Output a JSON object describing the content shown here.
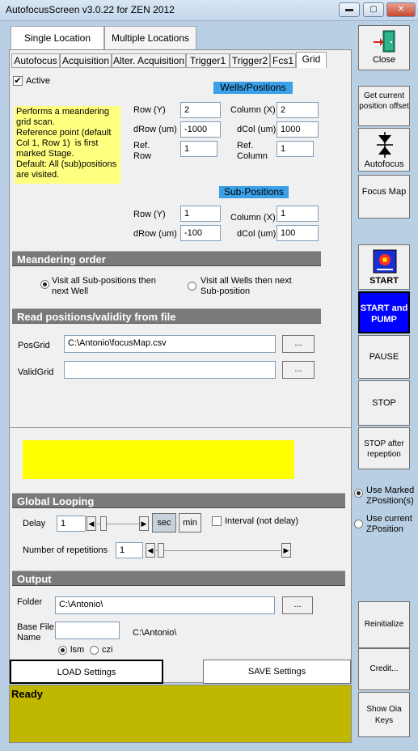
{
  "window": {
    "title": "AutofocusScreen v3.0.22 for ZEN 2012",
    "minimize": "▬",
    "maximize": "▢",
    "close": "✕"
  },
  "location_tabs": [
    "Single Location",
    "Multiple Locations"
  ],
  "sub_tabs": [
    "Autofocus",
    "Acquisition",
    "Alter. Acquisition",
    "Trigger1",
    "Trigger2",
    "Fcs1",
    "Grid"
  ],
  "grid": {
    "active_label": "Active",
    "active_checked": true,
    "info_text": "Performs a meandering grid scan.\nReference point (default Col 1, Row 1)  is first marked Stage.\nDefault: All (sub)positions are visited.",
    "wells_header": "Wells/Positions",
    "row_label": "Row (Y)",
    "row_value": "2",
    "column_label": "Column (X)",
    "column_value": "2",
    "drow_label": "dRow (um)",
    "drow_value": "-1000",
    "dcol_label": "dCol (um)",
    "dcol_value": "1000",
    "refrow_label": "Ref.\nRow",
    "refrow_value": "1",
    "refcol_label": "Ref.\nColumn",
    "refcol_value": "1",
    "subpos_header": "Sub-Positions",
    "sub_row_label": "Row (Y)",
    "sub_row_value": "1",
    "sub_column_label": "Column (X)",
    "sub_column_value": "1",
    "sub_drow_label": "dRow (um)",
    "sub_drow_value": "-100",
    "sub_dcol_label": "dCol (um)",
    "sub_dcol_value": "100"
  },
  "meander": {
    "title": "Meandering order",
    "option1": "Visit all Sub-positions then next Well",
    "option2": "Visit all Wells then next Sub-position",
    "selected": 1
  },
  "readpos": {
    "title": "Read positions/validity from file",
    "posgrid_label": "PosGrid",
    "posgrid_value": "C:\\Antonio\\focusMap.csv",
    "validgrid_label": "ValidGrid",
    "validgrid_value": "",
    "browse_label": "..."
  },
  "looping": {
    "title": "Global Looping",
    "delay_label": "Delay",
    "delay_value": "1",
    "sec_label": "sec",
    "min_label": "min",
    "interval_label": "Interval (not delay)",
    "reps_label": "Number of repetitions",
    "reps_value": "1"
  },
  "output": {
    "title": "Output",
    "folder_label": "Folder",
    "folder_value": "C:\\Antonio\\",
    "browse_label": "...",
    "basefile_label": "Base File\nName",
    "basefile_value": "",
    "path_display": "C:\\Antonio\\",
    "lsm_label": "lsm",
    "czi_label": "czi"
  },
  "settings": {
    "load_label": "LOAD Settings",
    "save_label": "SAVE Settings"
  },
  "status": {
    "text": "Ready"
  },
  "right_panel": {
    "close_label": "Close",
    "get_offset_label": "Get current position offset",
    "autofocus_label": "Autofocus",
    "focus_map_label": "Focus Map",
    "start_label": "START",
    "start_pump_label": "START and PUMP",
    "pause_label": "PAUSE",
    "stop_label": "STOP",
    "stop_after_label": "STOP after repeption",
    "use_marked_label": "Use Marked ZPosition(s)",
    "use_current_label": "Use current ZPosition",
    "reinit_label": "Reinitialize",
    "credit_label": "Credit...",
    "show_keys_label": "Show Oia Keys"
  },
  "colors": {
    "info_yellow": "#ffff80",
    "status_yellow": "#ffff00",
    "status_olive": "#c0b800",
    "section_gray": "#7a7a7a",
    "start_pump_blue": "#0000ff",
    "header_blue": "#3aa0e8"
  }
}
